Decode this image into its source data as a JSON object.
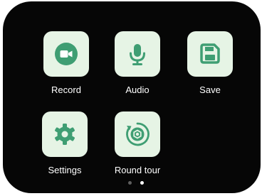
{
  "colors": {
    "screen_bg": "#060606",
    "tile_bg": "#e6f4e5",
    "icon_green": "#3f9e73",
    "label_text": "#ffffff"
  },
  "apps": [
    {
      "label": "Record",
      "icon": "video-camera-icon"
    },
    {
      "label": "Audio",
      "icon": "microphone-icon"
    },
    {
      "label": "Save",
      "icon": "floppy-disk-icon"
    },
    {
      "label": "Settings",
      "icon": "gear-icon"
    },
    {
      "label": "Round tour",
      "icon": "rotate-camera-icon"
    }
  ],
  "pager": {
    "page_count": 2,
    "current_page": 2
  }
}
